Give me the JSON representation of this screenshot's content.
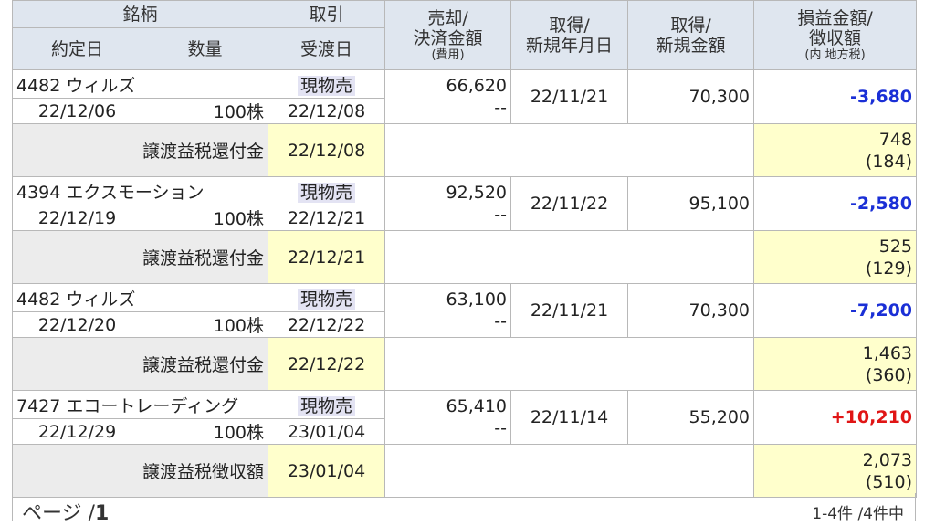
{
  "headers": {
    "stock": "銘柄",
    "trade": "取引",
    "contract_date": "約定日",
    "quantity": "数量",
    "delivery_date": "受渡日",
    "sale_line1": "売却/",
    "sale_line2": "決済金額",
    "sale_sub": "(費用)",
    "acq_date_line1": "取得/",
    "acq_date_line2": "新規年月日",
    "acq_amt_line1": "取得/",
    "acq_amt_line2": "新規金額",
    "pl_line1": "損益金額/",
    "pl_line2": "徴収額",
    "pl_sub": "(内 地方税)"
  },
  "rows": [
    {
      "stock": "4482 ウィルズ",
      "kind": "現物売",
      "contract_date": "22/12/06",
      "quantity": "100株",
      "delivery_date": "22/12/08",
      "sale_amount": "66,620",
      "cost": "--",
      "acq_date": "22/11/21",
      "acq_amount": "70,300",
      "pl": "-3,680",
      "tax_label": "譲渡益税還付金",
      "tax_date": "22/12/08",
      "tax_amount": "748",
      "tax_local": "(184)"
    },
    {
      "stock": "4394 エクスモーション",
      "kind": "現物売",
      "contract_date": "22/12/19",
      "quantity": "100株",
      "delivery_date": "22/12/21",
      "sale_amount": "92,520",
      "cost": "--",
      "acq_date": "22/11/22",
      "acq_amount": "95,100",
      "pl": "-2,580",
      "tax_label": "譲渡益税還付金",
      "tax_date": "22/12/21",
      "tax_amount": "525",
      "tax_local": "(129)"
    },
    {
      "stock": "4482 ウィルズ",
      "kind": "現物売",
      "contract_date": "22/12/20",
      "quantity": "100株",
      "delivery_date": "22/12/22",
      "sale_amount": "63,100",
      "cost": "--",
      "acq_date": "22/11/21",
      "acq_amount": "70,300",
      "pl": "-7,200",
      "tax_label": "譲渡益税還付金",
      "tax_date": "22/12/22",
      "tax_amount": "1,463",
      "tax_local": "(360)"
    },
    {
      "stock": "7427 エコートレーディング",
      "kind": "現物売",
      "contract_date": "22/12/29",
      "quantity": "100株",
      "delivery_date": "23/01/04",
      "sale_amount": "65,410",
      "cost": "--",
      "acq_date": "22/11/14",
      "acq_amount": "55,200",
      "pl": "+10,210",
      "tax_label": "譲渡益税徴収額",
      "tax_date": "23/01/04",
      "tax_amount": "2,073",
      "tax_local": "(510)"
    }
  ],
  "footer": {
    "page_prefix": "ページ /",
    "page_number": "1",
    "count": "1-4件 /4件中"
  },
  "colors": {
    "loss": "#1a2fd6",
    "gain": "#e01515",
    "header_bg": "#dfe6ef",
    "tax_bg": "#ffffcc"
  }
}
